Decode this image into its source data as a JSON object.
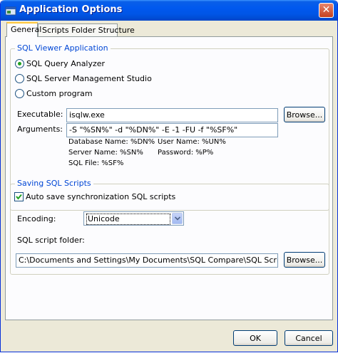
{
  "window": {
    "title": "Application Options"
  },
  "tabs": [
    {
      "label": "General",
      "active": true
    },
    {
      "label": "Scripts Folder Structure",
      "active": false
    }
  ],
  "sql_viewer": {
    "group_label": "SQL Viewer Application",
    "options": [
      {
        "label": "SQL Query Analyzer",
        "selected": true
      },
      {
        "label": "SQL Server Management Studio",
        "selected": false
      },
      {
        "label": "Custom program",
        "selected": false
      }
    ],
    "executable_label": "Executable:",
    "executable_value": "isqlw.exe",
    "arguments_label": "Arguments:",
    "arguments_value": "-S \"%SN%\" -d \"%DN%\" -E -1 -FU -f \"%SF%\"",
    "browse_label": "Browse...",
    "hints": {
      "database": "Database Name: %DN%",
      "user": "User Name: %UN%",
      "server": "Server Name: %SN%",
      "password": "Password:  %P%",
      "sqlfile": "SQL File: %SF%"
    }
  },
  "saving": {
    "group_label": "Saving SQL Scripts",
    "auto_save_label": "Auto save synchronization SQL scripts",
    "auto_save_checked": true,
    "encoding_label": "Encoding:",
    "encoding_value": "Unicode",
    "folder_label": "SQL script folder:",
    "folder_value": "C:\\Documents and Settings\\My Documents\\SQL Compare\\SQL Scripts\\",
    "browse_label": "Browse..."
  },
  "footer": {
    "ok_label": "OK",
    "cancel_label": "Cancel"
  },
  "colors": {
    "titlebar": "#0058ee",
    "group_label": "#0046d5",
    "face": "#ece9d8",
    "radio_dot": "#21a121"
  }
}
